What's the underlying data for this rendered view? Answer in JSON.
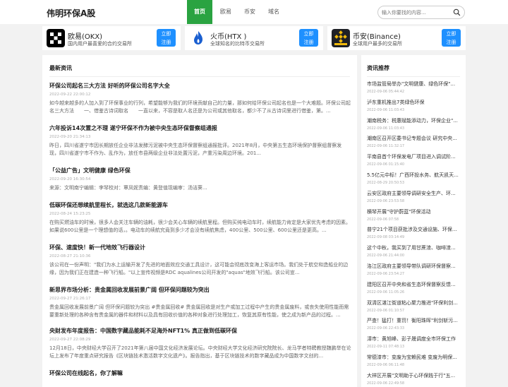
{
  "header": {
    "logo": "伟明环保A股",
    "nav": [
      "首页",
      "欧易",
      "币安",
      "域名"
    ],
    "search_placeholder": "输入你要找的内容..."
  },
  "exchanges": [
    {
      "name": "欧易(OKX)",
      "desc": "国内用户最喜爱的合约交易所",
      "btn1": "立即",
      "btn2": "注册",
      "icon": "okx-logo",
      "icon_color": "#000000"
    },
    {
      "name": "火币(HTX )",
      "desc": "全球知名的比特币交易所",
      "btn1": "立即",
      "btn2": "注册",
      "icon": "htx-logo",
      "icon_color": "#1a5fd0"
    },
    {
      "name": "币安(Binance)",
      "desc": "全球用户最多的交易所",
      "btn1": "立即",
      "btn2": "注册",
      "icon": "binance-logo",
      "icon_color": "#f0b90b"
    }
  ],
  "news": {
    "title": "最新资讯",
    "articles": [
      {
        "title": "环保公司起名三大方法 好听的环保公司名字大全",
        "date": "2022-09-22 22:00:12",
        "summary": "如今越来越多的人加入到了环保事业的行列，希望能够为我们的环境贡献自己的力量，那如何给环保公司起名也是一个大难题。环保公司起名三大方法　　一、借鉴古诗词取名　　一直以来，不容是取人名还是为公司或其他取名，都少不了从古诗词里进行借鉴，第。..."
      },
      {
        "title": "六年投诉14次置之不理 遂宁环保不作为被中央生态环保督察组通报",
        "date": "2022-09-20 21:34:13",
        "summary": "昨日，四川省遂宁市因长期放任企业非法发酵污泥被中央生态环保督察组通报批评。2021年8月，中央第五生态环境保护督察组督察发现，四川省遂宁市不作为、乱作为，放任市县两级企业非法处置污泥，产重污染周边环境。201..."
      },
      {
        "title": "「公益广告」文明健康 绿色环保",
        "date": "2022-09-20 16:30:54",
        "summary": "来源：文明南宁编辑：李琴校对：覃凤妮责编：黄登值现编审：汤洁葵..."
      },
      {
        "title": "低碳环保还想续航里程长，就选这几款新能源车",
        "date": "2022-08-24 15:23:25",
        "summary": "在购买燃油车的时候，很多人会关注车辆的油耗，很少会关心车辆的续航里程。但购买纯电动车时，续航能力肯定是大家优先考虑的因素。如果说600公里是一个理想值的话，。电动车的续航究竟到多少才会没有续航焦虑，400公里、500公里、600公里还是更高。..."
      },
      {
        "title": "环保、速度快！新一代地效飞行器设计",
        "date": "2022-08-27 21:10:36",
        "summary": "该公司在一份声明：\"我们为水上运输开发了先进的地面效应交通工具设计，这可能会彻底改变海上客运市场。我们处于航空和造船业的边缘，因为我们正在建造一种飞行船。\"以上宣传视频是RDC aqualines公司开发的\"aquas\"地效飞行船。该公司宣..."
      },
      {
        "title": "新思界市场分析：贵金属回收发展前景广阔 但环保问题较为突出",
        "date": "2022-09-27 21:26:17",
        "summary": "贵金属回收发展前景广阔 但环保问题较为突出 #贵金属回收# 贵金属回收是对生产或加工过程中产生的贵金属废料，或丧失使用性能而需要重新处理的各种含有贵金属的器件和材料以及具有回收价值的各种对象进行处理加工，恢复其原有性能，使之成为新产品的过程。..."
      },
      {
        "title": "央财发布年度报告：中国数字藏品能耗不足海外NFT1% 真正做到低碳环保",
        "date": "2022-09-27 22:08:29",
        "summary": "12月18日，中央财经大学召开了2021年第八届中国文化经济发展论坛。中央财经大学文化经济研究院院长、龙马学者特聘教授魏鹏举在论坛上发布了年度重点研究报告《区块链技术激活数字文化遗产》。报告指出，基于区块链技术的数字藏品成为中国数字文创的..."
      },
      {
        "title": "环保公司在线起名，你了解嘛",
        "date": "",
        "summary": ""
      }
    ]
  },
  "recommend": {
    "title": "资讯推荐",
    "items": [
      {
        "title": "市场监管局举办\"文明健康、绿色环保\"...",
        "date": "2022-09-06 05:44:42"
      },
      {
        "title": "泸东重机推出7类绿色环保",
        "date": "2022-09-06 11:03:43"
      },
      {
        "title": "潮南税务：税惠赋能添动力，环保企业\"...",
        "date": "2022-09-06 11:03:43"
      },
      {
        "title": "潮南区召开区委书记专题会议 研究中央...",
        "date": "2022-09-06 11:32:17"
      },
      {
        "title": "平南县首个环保发电厂项目进入调试阶...",
        "date": "2022-09-06 01:15:40"
      },
      {
        "title": "5.5亿元中标！广西环投水务、航天凯天...",
        "date": "2022-08-29 20:50:53"
      },
      {
        "title": "云安区政府主要领导调研安全生产、环...",
        "date": "2022-09-06 23:53:58"
      },
      {
        "title": "横琴开展\"守护蔚蓝\"环保活动",
        "date": "2022-09-06 07:58"
      },
      {
        "title": "普宁21个项目获批涉及交通设施、环保...",
        "date": "2022-09-08 03:14:49"
      },
      {
        "title": "这个中秋，我买到了用甘蔗渣、咖啡渣...",
        "date": "2022-09-06 21:44:00"
      },
      {
        "title": "洛江区政府主要领导带队调研环保督察...",
        "date": "2022-09-06 23:54:27"
      },
      {
        "title": "建阳区召开中央和省生态环保督察反馈...",
        "date": "2022-09-06 11:05:26"
      },
      {
        "title": "双清区湛江街道粘心聚力推进\"环保利剑...",
        "date": "2022-09-06 01:10:57"
      },
      {
        "title": "严查！猛打！重罚！衡阳珠晖\"利剑斩污...",
        "date": "2022-09-06 22:43:33"
      },
      {
        "title": "漳市：黄旭峰、彭子晟调度全市环保工作",
        "date": "2022-09-11 07:48:13"
      },
      {
        "title": "常德漆市：变废为宝赖民难 变废为明保...",
        "date": "2022-09-06 06:11:48"
      },
      {
        "title": "大祥区开展\"文明助于心环保践于行\"五...",
        "date": "2022-09-06 22:49:58"
      }
    ]
  }
}
